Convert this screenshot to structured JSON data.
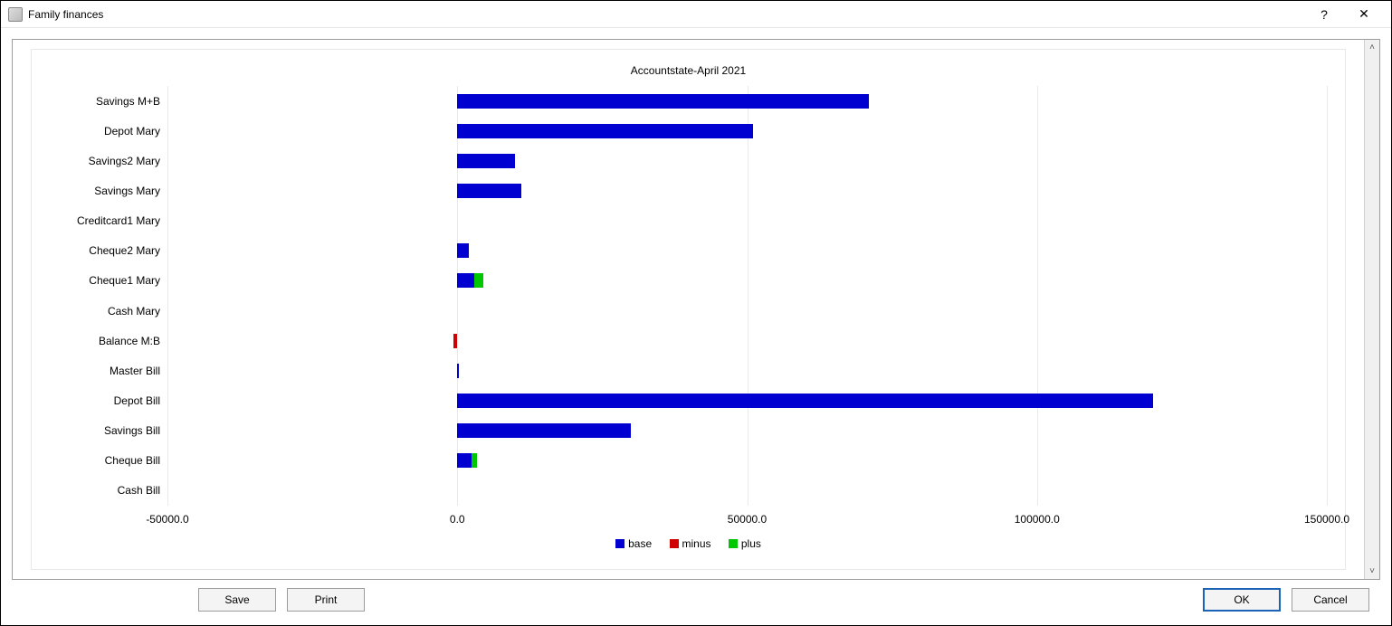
{
  "window": {
    "title": "Family finances"
  },
  "buttons": {
    "save": "Save",
    "print": "Print",
    "ok": "OK",
    "cancel": "Cancel"
  },
  "titlebar_icons": {
    "help": "?",
    "close": "✕"
  },
  "scrollbar": {
    "up": "˄",
    "down": "˅"
  },
  "legend": {
    "base": "base",
    "minus": "minus",
    "plus": "plus"
  },
  "chart_data": {
    "type": "bar",
    "title": "Accountstate-April 2021",
    "orientation": "horizontal",
    "xlabel": "",
    "ylabel": "",
    "xlim": [
      -50000,
      150000
    ],
    "x_ticks": [
      -50000,
      0,
      50000,
      100000,
      150000
    ],
    "x_tick_labels": [
      "-50000.0",
      "0.0",
      "50000.0",
      "100000.0",
      "150000.0"
    ],
    "categories": [
      "Savings M+B",
      "Depot Mary",
      "Savings2 Mary",
      "Savings Mary",
      "Creditcard1 Mary",
      "Cheque2 Mary",
      "Cheque1 Mary",
      "Cash Mary",
      "Balance M:B",
      "Master Bill",
      "Depot Bill",
      "Savings Bill",
      "Cheque Bill",
      "Cash Bill"
    ],
    "series": [
      {
        "name": "base",
        "values": [
          71000,
          51000,
          10000,
          11000,
          0,
          2000,
          3000,
          0,
          0,
          200,
          120000,
          30000,
          2500,
          0
        ]
      },
      {
        "name": "minus",
        "values": [
          0,
          0,
          0,
          0,
          0,
          0,
          0,
          0,
          -700,
          0,
          0,
          0,
          0,
          0
        ]
      },
      {
        "name": "plus",
        "values": [
          0,
          0,
          0,
          0,
          0,
          0,
          1500,
          0,
          0,
          0,
          0,
          0,
          900,
          0
        ]
      }
    ],
    "colors": {
      "base": "#0000d0",
      "minus": "#d00000",
      "plus": "#00c800"
    }
  }
}
